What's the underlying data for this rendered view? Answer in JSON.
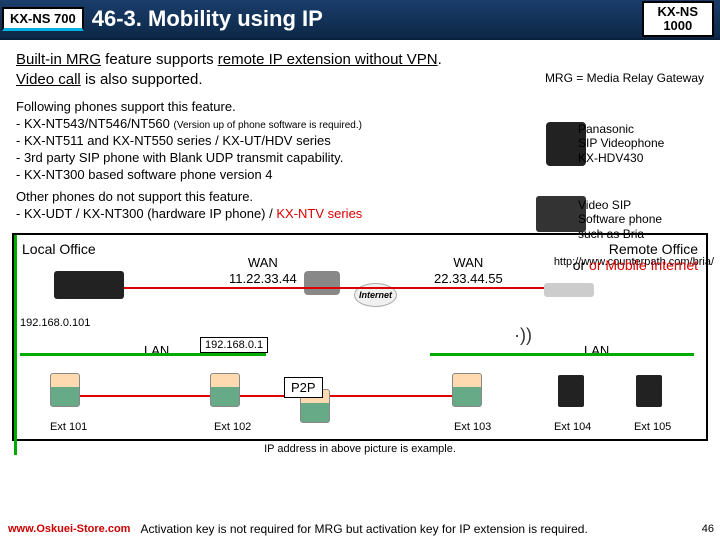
{
  "header": {
    "badge_left": "KX-NS 700",
    "title": "46-3. Mobility using IP",
    "badge_right_l1": "KX-NS",
    "badge_right_l2": "1000"
  },
  "intro": {
    "line1a": "Built-in MRG",
    "line1b": " feature supports ",
    "line1c": "remote IP extension without VPN",
    "line1d": ".",
    "line2a": "Video call",
    "line2b": " is also supported.",
    "mrg_note": "MRG = Media Relay Gateway"
  },
  "phones": {
    "lead": "Following phones support this feature.",
    "l1a": "- KX-NT543/NT546/NT560 ",
    "l1b": "(Version up of phone software is required.)",
    "l2": "- KX-NT511 and KX-NT550 series / KX-UT/HDV series",
    "l3": "- 3rd party SIP phone with Blank UDP transmit capability.",
    "l4": "- KX-NT300 based software phone version 4"
  },
  "side1": {
    "l1": "Panasonic",
    "l2": "SIP Videophone",
    "l3": "KX-HDV430"
  },
  "side2": {
    "l1": "Video SIP",
    "l2": "Software phone",
    "l3": "such as Bria"
  },
  "other": {
    "l1": "Other phones do not support this feature.",
    "l2a": "- KX-UDT / KX-NT300 (hardware IP phone) / ",
    "l2b": "KX-NTV series",
    "url": "http://www.counterpath.com/bria/"
  },
  "diagram": {
    "local": "Local Office",
    "remote_a": "Remote Office",
    "remote_b": "or Mobile Internet",
    "wan1_l1": "WAN",
    "wan1_l2": "11.22.33.44",
    "wan2_l1": "WAN",
    "wan2_l2": "22.33.44.55",
    "internet": "Internet",
    "lan": "LAN",
    "ip1": "192.168.0.101",
    "ip2": "192.168.0.1",
    "p2p": "P2P",
    "ext101": "Ext 101",
    "ext102": "Ext 102",
    "ext103": "Ext 103",
    "ext104": "Ext 104",
    "ext105": "Ext 105"
  },
  "footer": {
    "note": "IP address in above picture is example.",
    "store": "www.Oskuei-Store.com",
    "text_a": "Activation key is not required for MRG but activation key for IP extension is required.",
    "page": "46"
  }
}
